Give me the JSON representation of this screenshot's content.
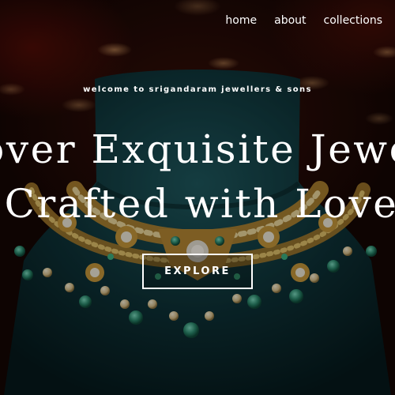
{
  "nav": {
    "items": [
      {
        "label": "home"
      },
      {
        "label": "about"
      },
      {
        "label": "collections"
      }
    ]
  },
  "hero": {
    "welcome": "welcome to srigandaram jewellers & sons",
    "headline_line1": "over Exquisite Jewe",
    "headline_line2": "Crafted with Love",
    "explore_label": "EXPLORE"
  },
  "colors": {
    "text": "#ffffff",
    "mannequin": "#0e2e32",
    "gold": "#c49a3a",
    "emerald": "#2c7a66",
    "background": "#2a0b06"
  }
}
